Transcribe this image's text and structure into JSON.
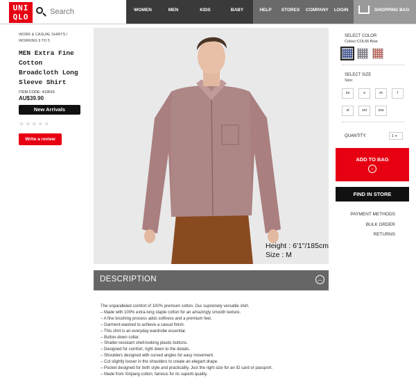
{
  "brand": {
    "logo_line1": "UNI",
    "logo_line2": "QLO"
  },
  "search": {
    "placeholder": "Search"
  },
  "nav": {
    "items": [
      "WOMEN",
      "MEN",
      "KIDS",
      "BABY"
    ],
    "secondary": [
      "HELP",
      "STORES",
      "COMPANY",
      "LOGIN"
    ],
    "bag_label": "SHOPPING BAG"
  },
  "product": {
    "breadcrumb_line1": "WORK & CASUAL SHIRTS /",
    "breadcrumb_line2": "WORKING 9 TO 5",
    "title": "MEN Extra Fine Cotton Broadcloth Long Sleeve Shirt",
    "item_code": "ITEM CODE: 419015",
    "price": "AU$39.90",
    "badge": "New Arrivals",
    "stars": "★★★★★",
    "review_button": "Write a review"
  },
  "photo": {
    "height": "Height : 6'1\"/185cm",
    "size": "Size : M"
  },
  "color": {
    "title": "SELECT COLOR",
    "selected": "Colour:COL66 Blue",
    "swatches": [
      {
        "name": "blue-gingham",
        "color": "#3b4f8a"
      },
      {
        "name": "grey-gingham",
        "color": "#7d7d86"
      },
      {
        "name": "red-gingham",
        "color": "#b5655c"
      }
    ]
  },
  "size": {
    "title": "SELECT SIZE",
    "subtitle": "Size:",
    "options": [
      "xs",
      "s",
      "m",
      "l",
      "xl",
      "xxl",
      "xxs"
    ]
  },
  "quantity": {
    "label": "QUANTITY:",
    "value": "1"
  },
  "actions": {
    "add_to_bag": "ADD TO BAG",
    "find_in_store": "FIND IN STORE"
  },
  "links": [
    "PAYMENT METHODS",
    "BULK ORDER",
    "RETURNS"
  ],
  "description": {
    "heading": "DESCRIPTION",
    "lines": [
      "The unparalleled comfort of 100% premium cotton. Our supremely versatile shirt.",
      "– Made with 100% extra-long staple cotton for an amazingly smooth texture.",
      "– A fine brushing process adds softness and a premium feel.",
      "– Garment-washed to achieve a casual finish.",
      "– This shirt is an everyday wardrobe essential.",
      "– Button-down collar.",
      "– Shatter-resistant shell-looking plastic buttons.",
      "– Designed for comfort, right down to the details.",
      "– Shoulders designed with curved angles for easy movement.",
      "– Cut slightly looser in the shoulders to create an elegant drape.",
      "– Pocket designed for both style and practicality. Just the right size for an ID card or passport.",
      "– Made from Xinjiang cotton, famous for its superb quality."
    ]
  }
}
